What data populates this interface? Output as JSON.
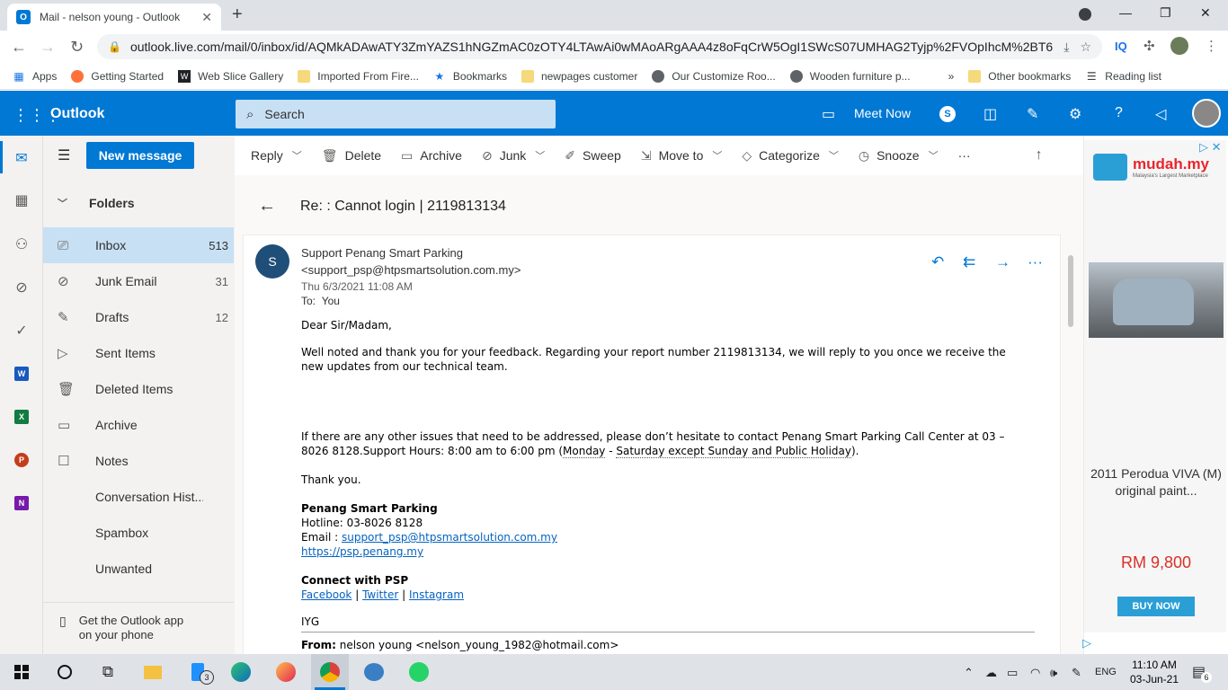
{
  "browser": {
    "tab_title": "Mail - nelson young - Outlook",
    "tab_icon": "O",
    "url": "outlook.live.com/mail/0/inbox/id/AQMkADAwATY3ZmYAZS1hNGZmAC0zOTY4LTAwAi0wMAoARgAAA4z8oFqCrW5OgI1SWcS07UMHAG2Tyjp%2FVOpIhcM%2BT6...",
    "bookmarks": [
      {
        "label": "Apps",
        "icon": "apps-icon"
      },
      {
        "label": "Getting Started",
        "icon": "firefox-icon"
      },
      {
        "label": "Web Slice Gallery",
        "icon": "web-slice-icon"
      },
      {
        "label": "Imported From Fire...",
        "icon": "folder-icon"
      },
      {
        "label": "Bookmarks",
        "icon": "star-icon"
      },
      {
        "label": "newpages customer",
        "icon": "folder-icon"
      },
      {
        "label": "Our Customize Roo...",
        "icon": "globe-icon"
      },
      {
        "label": "Wooden furniture p...",
        "icon": "globe-icon"
      }
    ],
    "overflow": "»",
    "other_bookmarks": "Other bookmarks",
    "reading_list": "Reading list",
    "iq_label": "IQ"
  },
  "outlook": {
    "app_title": "Outlook",
    "search_placeholder": "Search",
    "meet_now": "Meet Now",
    "new_message": "New message",
    "folders_header": "Folders",
    "folders": [
      {
        "label": "Inbox",
        "count": "513"
      },
      {
        "label": "Junk Email",
        "count": "31"
      },
      {
        "label": "Drafts",
        "count": "12"
      },
      {
        "label": "Sent Items",
        "count": ""
      },
      {
        "label": "Deleted Items",
        "count": ""
      },
      {
        "label": "Archive",
        "count": ""
      },
      {
        "label": "Notes",
        "count": ""
      },
      {
        "label": "Conversation Hist...",
        "count": ""
      },
      {
        "label": "Spambox",
        "count": ""
      },
      {
        "label": "Unwanted",
        "count": ""
      }
    ],
    "get_app": "Get the Outlook app on your phone",
    "commands": {
      "reply": "Reply",
      "delete": "Delete",
      "archive": "Archive",
      "junk": "Junk",
      "sweep": "Sweep",
      "move_to": "Move to",
      "categorize": "Categorize",
      "snooze": "Snooze",
      "more": "···"
    }
  },
  "message": {
    "subject": "Re: : Cannot login | 2119813134",
    "avatar_letter": "S",
    "sender": "Support Penang Smart Parking <support_psp@htpsmartsolution.com.my>",
    "date": "Thu 6/3/2021 11:08 AM",
    "to_label": "To:",
    "to_value": "You",
    "greeting": "Dear Sir/Madam,",
    "para1": "Well noted and  thank you for your feedback. Regarding your report number  2119813134, we will reply to you once we receive the new updates from our technical team.",
    "para2_start": "If there are any other issues that need to be addressed, please don’t hesitate to contact Penang Smart Parking Call Center at 03 – 8026 8128.Support Hours: 8:00 am to 6:00 pm (",
    "para2_days1": "Monday",
    "para2_sep": " - ",
    "para2_days2": "Saturday except Sunday and Public Holiday",
    "para2_end": ").",
    "thanks": "Thank you.",
    "sig_name": "Penang Smart Parking",
    "hotline": "Hotline: 03-8026 8128",
    "email_label": "Email : ",
    "email_link": "support_psp@htpsmartsolution.com.my",
    "website": "https://psp.penang.my",
    "connect": "Connect with PSP",
    "social": [
      "Facebook",
      "Twitter",
      "Instagram"
    ],
    "social_sep": " | ",
    "initials": "IYG",
    "from_label": "From:",
    "from_value": " nelson young <nelson_young_1982@hotmail.com>"
  },
  "ad": {
    "brand": "mudah.my",
    "tagline": "Malaysia's Largest Marketplace",
    "title": "2011 Perodua VIVA (M) original paint...",
    "price": "RM 9,800",
    "button": "BUY NOW"
  },
  "taskbar": {
    "time": "11:10 AM",
    "date": "03-Jun-21",
    "lang": "ENG",
    "notif_count": "6",
    "badge": "3"
  }
}
